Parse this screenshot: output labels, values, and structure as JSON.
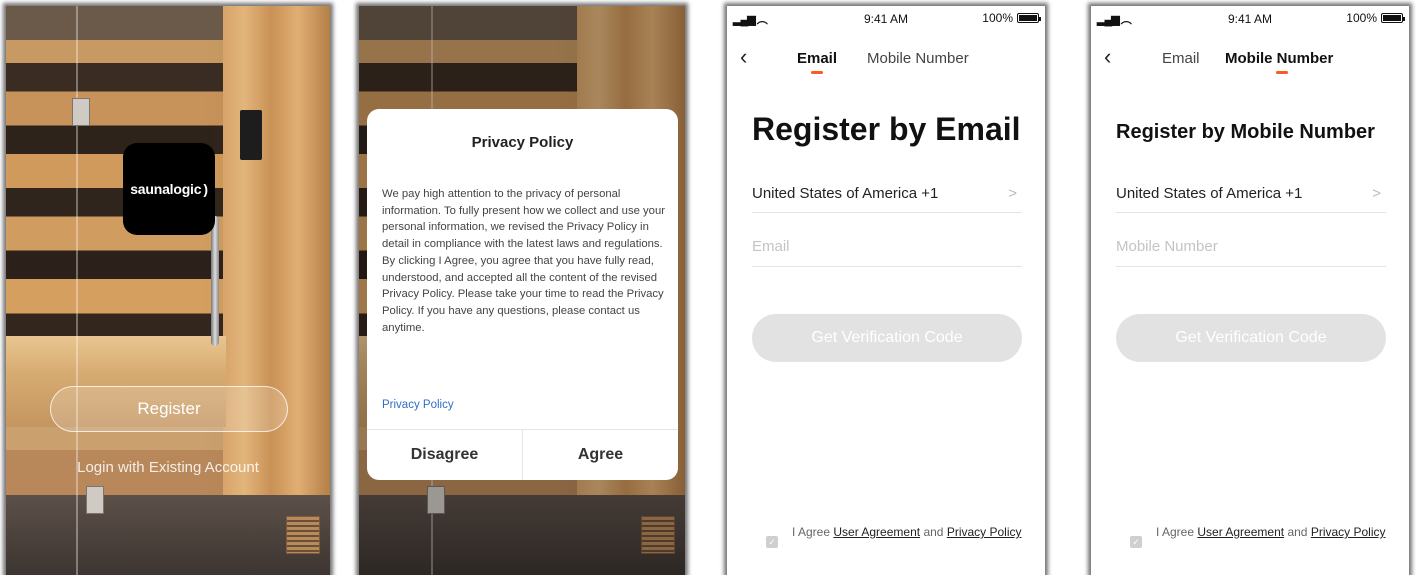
{
  "login_screen": {
    "logo_text": "saunalogic",
    "logo_mark": ")",
    "register_label": "Register",
    "login_label": "Login with Existing Account"
  },
  "privacy_dialog": {
    "title": "Privacy Policy",
    "body": "We pay high attention to the privacy of personal information. To fully present how we collect and use your personal information, we revised the Privacy Policy in detail in compliance with the latest laws and regulations. By clicking I Agree, you agree that you have fully read, understood, and accepted all the content of the revised Privacy Policy. Please take your time to read the Privacy Policy. If you have any questions, please contact us anytime.",
    "link": "Privacy Policy",
    "disagree": "Disagree",
    "agree": "Agree"
  },
  "status_bar": {
    "time": "9:41 AM",
    "battery": "100%"
  },
  "email_screen": {
    "tabs": [
      "Email",
      "Mobile Number"
    ],
    "heading": "Register by Email",
    "country": "United States of America +1",
    "placeholder": "Email",
    "button": "Get Verification Code",
    "agree_prefix": "I Agree",
    "user_agreement": "User Agreement",
    "and": "and",
    "privacy_policy": "Privacy Policy"
  },
  "mobile_screen": {
    "tabs": [
      "Email",
      "Mobile Number"
    ],
    "heading": "Register by Mobile Number",
    "country": "United States of America +1",
    "placeholder": "Mobile Number",
    "button": "Get Verification Code",
    "agree_prefix": "I Agree",
    "user_agreement": "User Agreement",
    "and": "and",
    "privacy_policy": "Privacy Policy"
  },
  "colors": {
    "tab_indicator": "#ff5a1f",
    "link_blue": "#2f6fc7",
    "disabled_button": "#e2e2e2"
  }
}
